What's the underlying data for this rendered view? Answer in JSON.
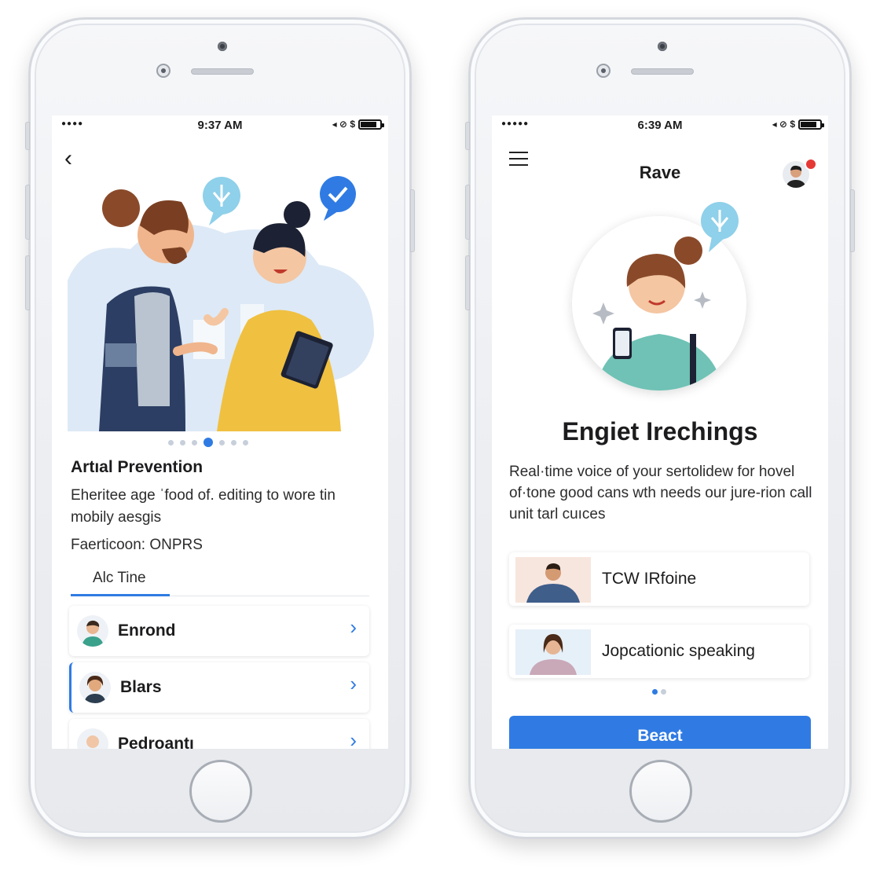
{
  "left_screen": {
    "status": {
      "signal": "●●●●",
      "time": "9:37 AM",
      "icons": "◂ ⊘ $"
    },
    "hero": {
      "description": "illustration of two people talking with speech bubbles"
    },
    "carousel": {
      "count": 7,
      "active_index": 3
    },
    "article": {
      "title": "Artıal Prevention",
      "body": "Eheritee age ˈfood of. editing to wore tin mobily aesgis",
      "meta": "Faerticoon: ONPRS"
    },
    "tab": {
      "label": "Alc Tine"
    },
    "list": [
      {
        "label": "Enrond",
        "selected": false
      },
      {
        "label": "Blars",
        "selected": true
      },
      {
        "label": "Pedroantı",
        "selected": false
      }
    ]
  },
  "right_screen": {
    "status": {
      "signal": "●●●●●",
      "time": "6:39 AM",
      "icons": "◂ ⊘ $"
    },
    "header": {
      "title": "Rave"
    },
    "title": "Engiet Irechings",
    "body": "Real·time voice of your sertolidew for hovel of·tone good cans wth needs our jure-rion call unit tarl cuıces",
    "features": [
      {
        "label": "TCW IRfoine"
      },
      {
        "label": "Jopcationic speaking"
      }
    ],
    "pager": {
      "count": 2,
      "active_index": 0
    },
    "cta": {
      "label": "Beact"
    }
  },
  "colors": {
    "accent": "#2f7be3",
    "notification": "#e53935",
    "illustration_blue": "#dde9f6"
  }
}
